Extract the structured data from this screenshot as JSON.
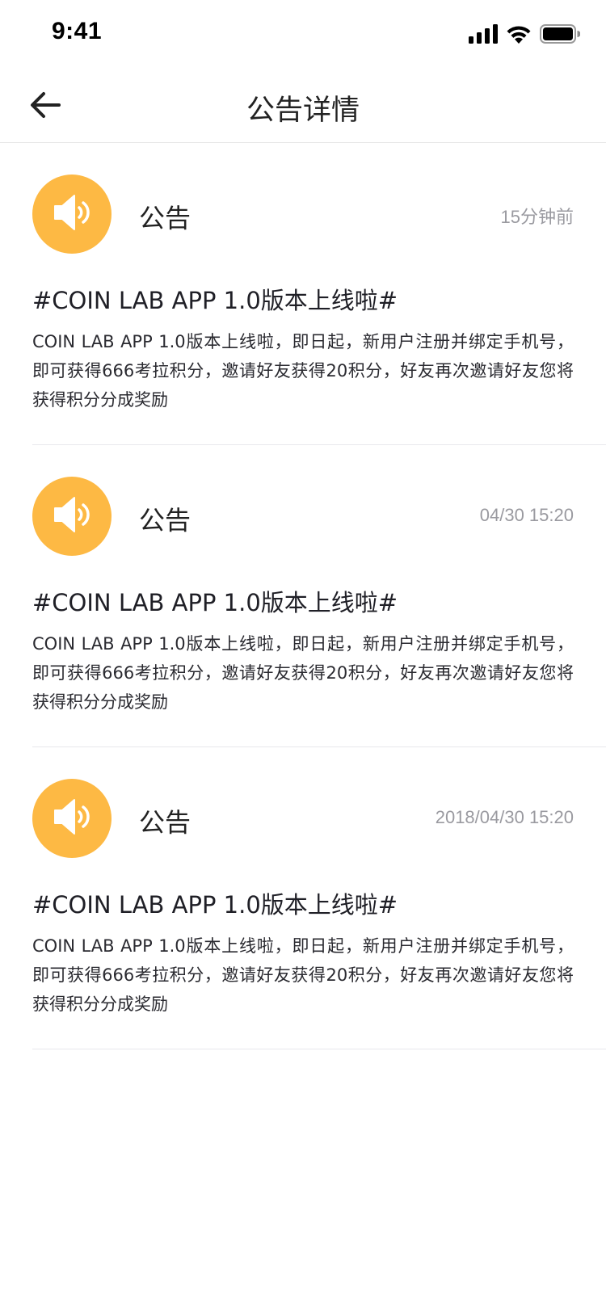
{
  "status_bar": {
    "time": "9:41"
  },
  "nav": {
    "title": "公告详情",
    "back_icon": "arrow-left-icon"
  },
  "announcements": [
    {
      "label": "公告",
      "time": "15分钟前",
      "title": "#COIN LAB APP 1.0版本上线啦#",
      "body": "COIN LAB APP 1.0版本上线啦，即日起，新用户注册并绑定手机号，即可获得666考拉积分，邀请好友获得20积分，好友再次邀请好友您将获得积分分成奖励",
      "icon": "speaker-icon"
    },
    {
      "label": "公告",
      "time": "04/30 15:20",
      "title": "#COIN LAB APP 1.0版本上线啦#",
      "body": "COIN LAB APP 1.0版本上线啦，即日起，新用户注册并绑定手机号，即可获得666考拉积分，邀请好友获得20积分，好友再次邀请好友您将获得积分分成奖励",
      "icon": "speaker-icon"
    },
    {
      "label": "公告",
      "time": "2018/04/30 15:20",
      "title": "#COIN LAB APP 1.0版本上线啦#",
      "body": "COIN LAB APP 1.0版本上线啦，即日起，新用户注册并绑定手机号，即可获得666考拉积分，邀请好友获得20积分，好友再次邀请好友您将获得积分分成奖励",
      "icon": "speaker-icon"
    }
  ],
  "colors": {
    "accent": "#fdb944",
    "text_primary": "#1f1f26",
    "text_secondary": "#9a9aa0",
    "divider": "#e8e8ec"
  }
}
